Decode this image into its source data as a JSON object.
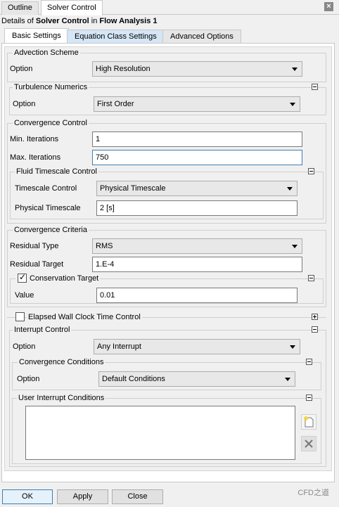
{
  "top_tabs": {
    "outline": "Outline",
    "solver_control": "Solver Control"
  },
  "close_icon": "×",
  "details": {
    "prefix": "Details of ",
    "object": "Solver Control",
    "middle": " in ",
    "parent": "Flow Analysis 1"
  },
  "inner_tabs": {
    "basic": "Basic Settings",
    "equation": "Equation Class Settings",
    "advanced": "Advanced Options"
  },
  "advection": {
    "title": "Advection Scheme",
    "option_label": "Option",
    "option_value": "High Resolution"
  },
  "turbulence": {
    "title": "Turbulence Numerics",
    "option_label": "Option",
    "option_value": "First Order"
  },
  "convergence_control": {
    "title": "Convergence Control",
    "min_label": "Min. Iterations",
    "min_value": "1",
    "max_label": "Max. Iterations",
    "max_value": "750",
    "fluid_timescale": {
      "title": "Fluid Timescale Control",
      "timescale_label": "Timescale Control",
      "timescale_value": "Physical Timescale",
      "physical_label": "Physical Timescale",
      "physical_value": "2 [s]"
    }
  },
  "convergence_criteria": {
    "title": "Convergence Criteria",
    "residual_type_label": "Residual Type",
    "residual_type_value": "RMS",
    "residual_target_label": "Residual Target",
    "residual_target_value": "1.E-4",
    "conservation": {
      "label": "Conservation Target",
      "checked": true,
      "value_label": "Value",
      "value": "0.01"
    }
  },
  "elapsed": {
    "label": "Elapsed Wall Clock Time Control",
    "checked": false
  },
  "interrupt": {
    "title": "Interrupt Control",
    "option_label": "Option",
    "option_value": "Any Interrupt",
    "conditions": {
      "title": "Convergence Conditions",
      "option_label": "Option",
      "option_value": "Default Conditions"
    },
    "user": {
      "title": "User Interrupt Conditions"
    }
  },
  "buttons": {
    "ok": "OK",
    "apply": "Apply",
    "close": "Close"
  },
  "watermark": "CFD之道",
  "icons": {
    "collapse": "minus-box-icon",
    "expand": "plus-box-icon",
    "new": "new-item-icon",
    "delete": "delete-icon",
    "dropdown": "chevron-down-icon"
  }
}
